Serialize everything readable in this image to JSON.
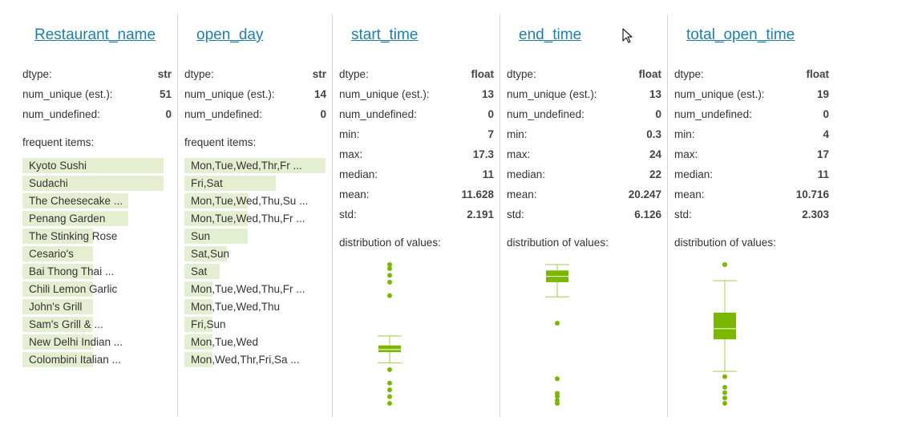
{
  "accent_color": "#1a7fb5",
  "plot_color": "#7ab800",
  "bar_color": "#e4efd2",
  "labels": {
    "dtype": "dtype:",
    "num_unique": "num_unique (est.):",
    "num_undefined": "num_undefined:",
    "frequent_items": "frequent items:",
    "distribution": "distribution of values:",
    "min": "min:",
    "max": "max:",
    "median": "median:",
    "mean": "mean:",
    "std": "std:"
  },
  "columns": [
    {
      "name": "Restaurant_name",
      "dtype": "str",
      "num_unique": "51",
      "num_undefined": "0",
      "frequent_items": [
        {
          "label": "Kyoto Sushi",
          "fraction": 1.0
        },
        {
          "label": "Sudachi",
          "fraction": 1.0
        },
        {
          "label": "The Cheesecake ...",
          "fraction": 0.75
        },
        {
          "label": "Penang Garden",
          "fraction": 0.75
        },
        {
          "label": "The Stinking Rose",
          "fraction": 0.5
        },
        {
          "label": "Cesario's",
          "fraction": 0.5
        },
        {
          "label": "Bai Thong Thai ...",
          "fraction": 0.5
        },
        {
          "label": "Chili Lemon Garlic",
          "fraction": 0.5
        },
        {
          "label": "John's Grill",
          "fraction": 0.5
        },
        {
          "label": "Sam's Grill & ...",
          "fraction": 0.5
        },
        {
          "label": "New Delhi Indian ...",
          "fraction": 0.5
        },
        {
          "label": "Colombini Italian ...",
          "fraction": 0.5
        }
      ]
    },
    {
      "name": "open_day",
      "dtype": "str",
      "num_unique": "14",
      "num_undefined": "0",
      "frequent_items": [
        {
          "label": "Mon,Tue,Wed,Thr,Fr ...",
          "fraction": 1.0
        },
        {
          "label": "Fri,Sat",
          "fraction": 0.65
        },
        {
          "label": "Mon,Tue,Wed,Thu,Su ...",
          "fraction": 0.45
        },
        {
          "label": "Mon,Tue,Wed,Thu,Fr ...",
          "fraction": 0.45
        },
        {
          "label": "Sun",
          "fraction": 0.45
        },
        {
          "label": "Sat,Sun",
          "fraction": 0.3
        },
        {
          "label": "Sat",
          "fraction": 0.25
        },
        {
          "label": "Mon,Tue,Wed,Thu,Fr ...",
          "fraction": 0.2
        },
        {
          "label": "Mon,Tue,Wed,Thu",
          "fraction": 0.2
        },
        {
          "label": "Fri,Sun",
          "fraction": 0.2
        },
        {
          "label": "Mon,Tue,Wed",
          "fraction": 0.2
        },
        {
          "label": "Mon,Wed,Thr,Fri,Sa ...",
          "fraction": 0.2
        }
      ]
    },
    {
      "name": "start_time",
      "dtype": "float",
      "num_unique": "13",
      "num_undefined": "0",
      "min": "7",
      "max": "17.3",
      "median": "11",
      "mean": "11.628",
      "std": "2.191",
      "box": {
        "min": 7,
        "q1": 10.8,
        "median": 11,
        "q3": 11.3,
        "whisker_low": 10,
        "whisker_high": 12,
        "outliers": [
          7,
          7.5,
          8,
          8.5,
          9.5,
          15,
          16,
          16.5,
          17,
          17.3
        ]
      }
    },
    {
      "name": "end_time",
      "dtype": "float",
      "num_unique": "13",
      "num_undefined": "0",
      "min": "0.3",
      "max": "24",
      "median": "22",
      "mean": "20.247",
      "std": "6.126",
      "box": {
        "q1": 21,
        "median": 22,
        "q3": 23,
        "whisker_low": 18.5,
        "whisker_high": 24,
        "outliers": [
          0.3,
          0.8,
          1.5,
          2.0,
          4.5,
          14
        ]
      }
    },
    {
      "name": "total_open_time",
      "dtype": "float",
      "num_unique": "19",
      "num_undefined": "0",
      "min": "4",
      "max": "17",
      "median": "11",
      "mean": "10.716",
      "std": "2.303",
      "box": {
        "q1": 10,
        "median": 11,
        "q3": 12.5,
        "whisker_low": 7,
        "whisker_high": 15.5,
        "outliers": [
          4,
          4.5,
          5,
          5.5,
          6.5,
          17
        ]
      }
    }
  ]
}
